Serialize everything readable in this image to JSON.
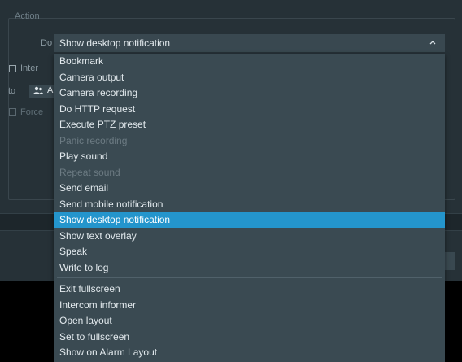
{
  "dialog": {
    "section_title": "Action",
    "do_label": "Do",
    "action_combo_value": "Show desktop notification",
    "intercom_label": "Inter",
    "to_label": "to",
    "users_button_text": "A",
    "force_label": "Force"
  },
  "dropdown": {
    "items": [
      {
        "label": "Bookmark",
        "state": "enabled"
      },
      {
        "label": "Camera output",
        "state": "enabled"
      },
      {
        "label": "Camera recording",
        "state": "enabled"
      },
      {
        "label": "Do HTTP request",
        "state": "enabled"
      },
      {
        "label": "Execute PTZ preset",
        "state": "enabled"
      },
      {
        "label": "Panic recording",
        "state": "disabled"
      },
      {
        "label": "Play sound",
        "state": "enabled"
      },
      {
        "label": "Repeat sound",
        "state": "disabled"
      },
      {
        "label": "Send email",
        "state": "enabled"
      },
      {
        "label": "Send mobile notification",
        "state": "enabled"
      },
      {
        "label": "Show desktop notification",
        "state": "selected"
      },
      {
        "label": "Show text overlay",
        "state": "enabled"
      },
      {
        "label": "Speak",
        "state": "enabled"
      },
      {
        "label": "Write to log",
        "state": "enabled"
      }
    ],
    "extra_items": [
      {
        "label": "Exit fullscreen",
        "state": "enabled"
      },
      {
        "label": "Intercom informer",
        "state": "enabled"
      },
      {
        "label": "Open layout",
        "state": "enabled"
      },
      {
        "label": "Set to fullscreen",
        "state": "enabled"
      },
      {
        "label": "Show on Alarm Layout",
        "state": "enabled"
      }
    ]
  },
  "colors": {
    "selected_bg": "#2495cc",
    "menu_bg": "#3a4a52",
    "panel_bg": "#263137"
  }
}
